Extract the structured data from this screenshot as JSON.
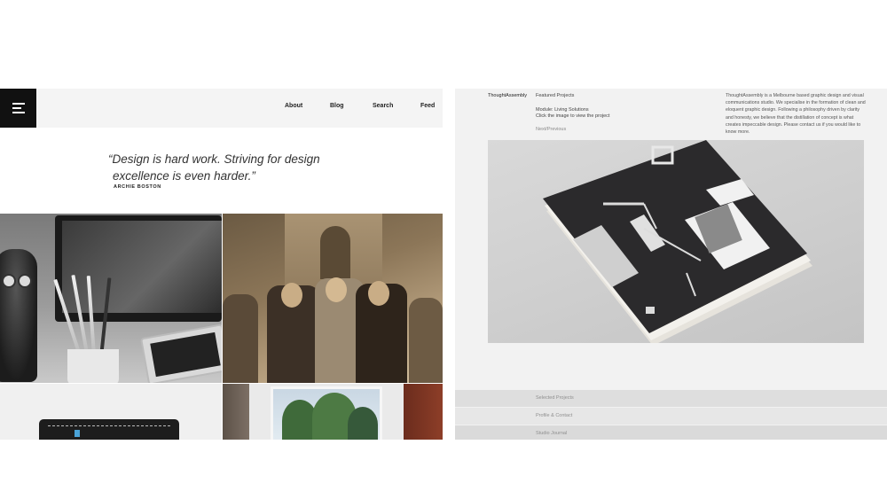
{
  "left": {
    "nav": {
      "menu_icon": "hamburger-menu-icon",
      "items": [
        "About",
        "Blog",
        "Search",
        "Feed"
      ]
    },
    "quote": {
      "line1": "“Design is hard work. Striving for design",
      "line2": "excellence is even harder.”",
      "author": "ARCHIE BOSTON"
    }
  },
  "right": {
    "brand": "ThoughtAssembly",
    "section": "Featured Projects",
    "project_module": "Module: Living Solutions",
    "project_hint": "Click the image to view the project",
    "pager": "Next/Previous",
    "about": "ThoughtAssembly is a Melbourne based graphic design and visual communications studio. We specialise in the formation of clean and eloquent graphic design. Following a philosophy driven by clarity and honesty, we believe that the distillation of concept is what creates impeccable design. Please contact us if you would like to know more.",
    "footer_links": [
      "Selected Projects",
      "Profile & Contact",
      "Studio Journal"
    ]
  },
  "colors": {
    "menu_bg": "#111111",
    "left_topbar": "#f4f4f4",
    "right_bg": "#f2f2f2",
    "booklet_dark": "#2b2a2c"
  }
}
